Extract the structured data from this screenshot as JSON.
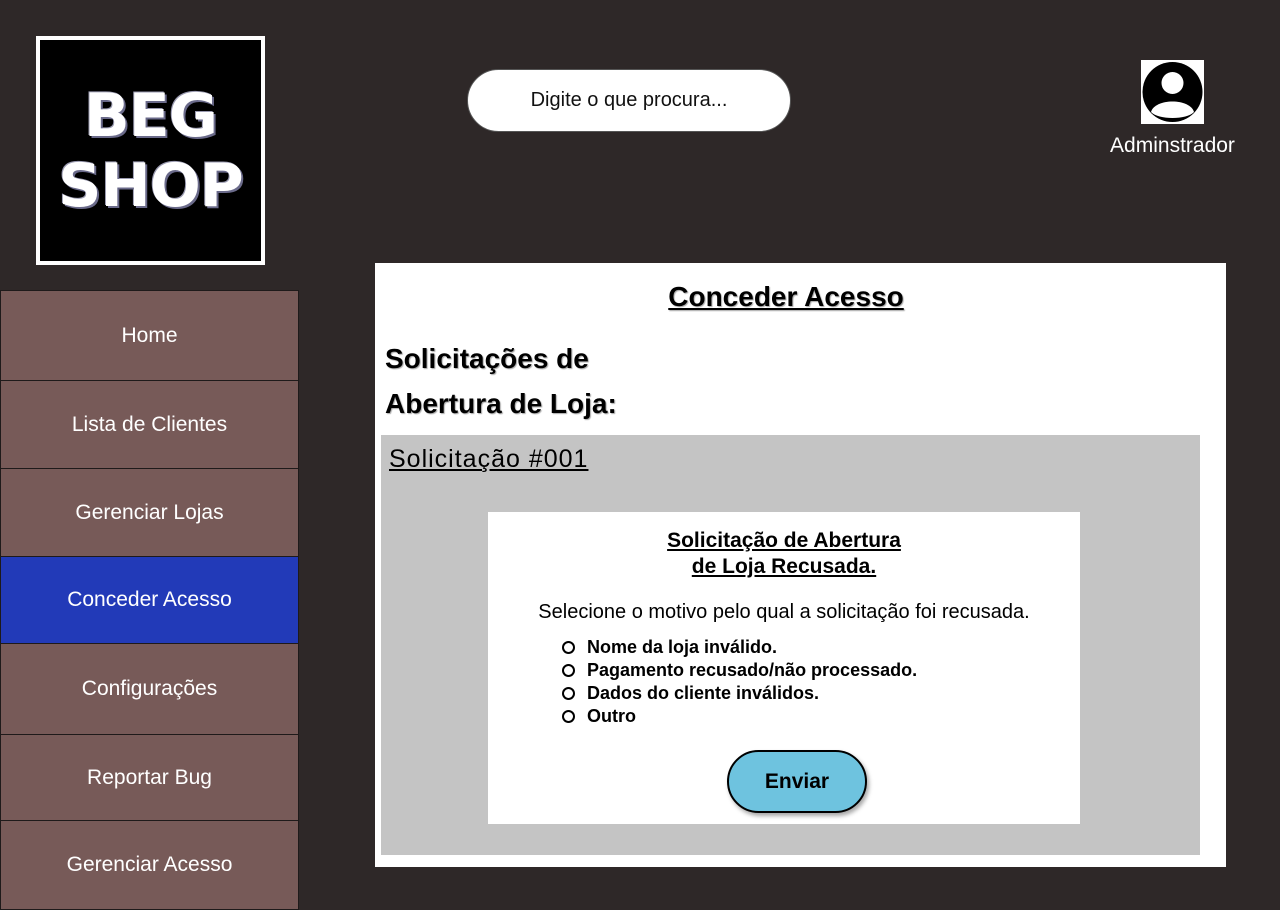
{
  "logo": {
    "line1": "BEG",
    "line2": "SHOP"
  },
  "search": {
    "placeholder": "Digite o que procura..."
  },
  "user": {
    "name": "Adminstrador",
    "icon": "user-avatar-icon"
  },
  "sidebar": {
    "active": "Conceder Acesso",
    "items": [
      {
        "label": "Home"
      },
      {
        "label": "Lista de Clientes"
      },
      {
        "label": "Gerenciar Lojas"
      },
      {
        "label": "Conceder Acesso"
      },
      {
        "label": "Configurações"
      },
      {
        "label": "Reportar Bug"
      },
      {
        "label": "Gerenciar Acesso"
      }
    ]
  },
  "main": {
    "title": "Conceder Acesso",
    "section_title_line1": "Solicitações de",
    "section_title_line2": "Abertura de Loja:",
    "request": {
      "id_label": "Solicitação #001",
      "dialog": {
        "title_line1": "Solicitação de Abertura",
        "title_line2": "de Loja Recusada.",
        "prompt": "Selecione o motivo pelo qual a solicitação foi recusada.",
        "options": [
          {
            "label": "Nome da loja inválido."
          },
          {
            "label": "Pagamento recusado/não processado."
          },
          {
            "label": "Dados do cliente inválidos."
          },
          {
            "label": "Outro"
          }
        ],
        "submit_label": "Enviar"
      }
    }
  },
  "colors": {
    "background": "#2e2828",
    "nav_item": "#775a58",
    "nav_active": "#223ab8",
    "request_box": "#c4c4c4",
    "submit_button": "#6ec3df"
  }
}
